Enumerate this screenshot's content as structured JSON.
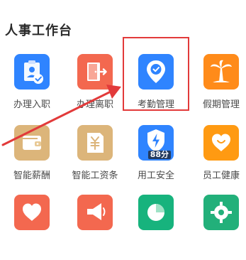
{
  "section": {
    "title": "人事工作台"
  },
  "items": [
    {
      "label": "办理入职",
      "icon": "id-card-check-icon",
      "color": "#2f84ff"
    },
    {
      "label": "办理离职",
      "icon": "exit-door-icon",
      "color": "#f3684f"
    },
    {
      "label": "考勤管理",
      "icon": "location-check-icon",
      "color": "#2f84ff"
    },
    {
      "label": "假期管理",
      "icon": "palm-tree-icon",
      "color": "#ff8b1a"
    },
    {
      "label": "智能薪酬",
      "icon": "wallet-icon",
      "color": "#dcb57a"
    },
    {
      "label": "智能工资条",
      "icon": "yuan-document-icon",
      "color": "#dcb57a"
    },
    {
      "label": "用工安全",
      "icon": "shield-lightning-icon",
      "color": "#2f84ff",
      "badge": "88分"
    },
    {
      "label": "员工健康",
      "icon": "heart-icon",
      "color": "#ff9a12"
    },
    {
      "label": "",
      "icon": "heart-icon",
      "color": "#f3684f"
    },
    {
      "label": "",
      "icon": "megaphone-icon",
      "color": "#f3684f"
    },
    {
      "label": "",
      "icon": "pie-chart-icon",
      "color": "#17b37d"
    },
    {
      "label": "",
      "icon": "gear-icon",
      "color": "#22b07a"
    }
  ],
  "highlight": {
    "color": "#e23a3a"
  }
}
